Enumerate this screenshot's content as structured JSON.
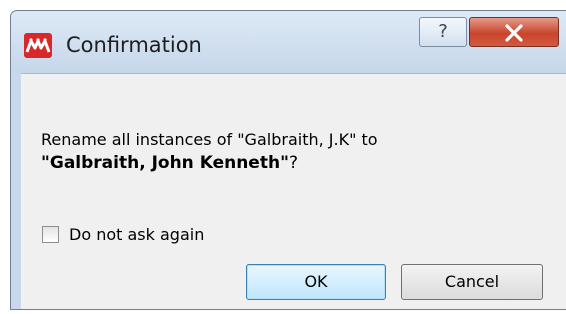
{
  "window": {
    "title": "Confirmation",
    "app_icon": "app-logo-icon",
    "help_icon": "help-icon",
    "help_glyph": "?",
    "close_icon": "close-icon"
  },
  "message": {
    "line1": "Rename all instances of \"Galbraith, J.K\" to",
    "line2_open_quote": "\"",
    "line2_bold": "Galbraith, John Kenneth",
    "line2_close_quote": "\"",
    "line2_suffix": "?"
  },
  "checkbox": {
    "label": "Do not ask again",
    "checked": false
  },
  "buttons": {
    "ok_label": "OK",
    "cancel_label": "Cancel"
  },
  "colors": {
    "accent": "#d8282a",
    "close_button": "#c8452c",
    "default_button_border": "#3c7fb1"
  }
}
